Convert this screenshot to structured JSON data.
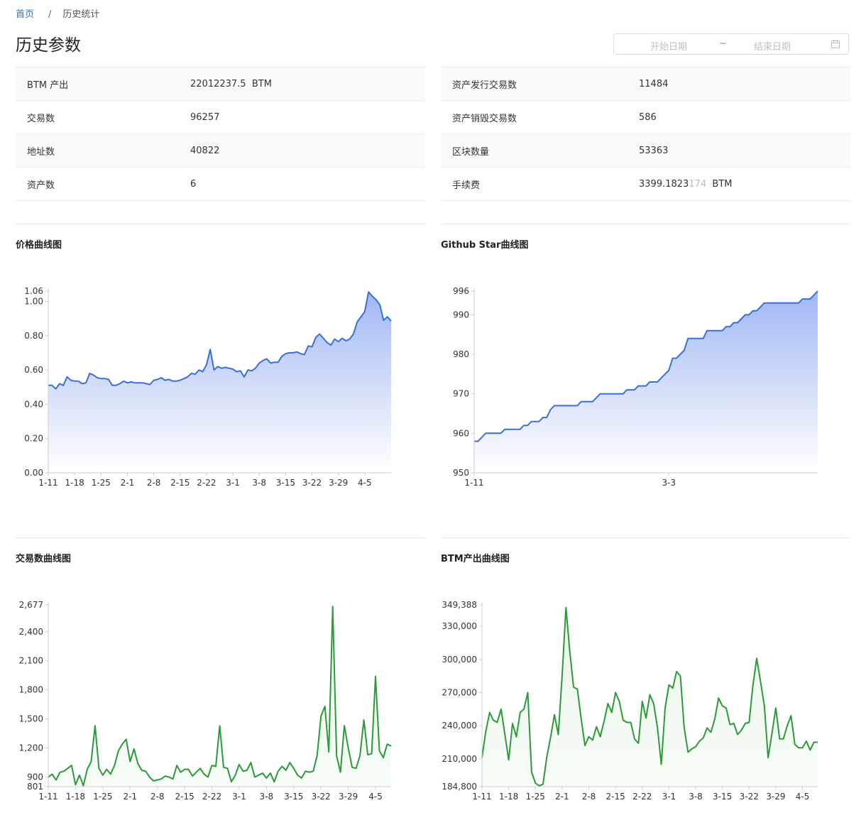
{
  "breadcrumb": {
    "home": "首页",
    "separator": "/",
    "current": "历史统计"
  },
  "page_title": "历史参数",
  "date_range": {
    "start_placeholder": "开始日期",
    "separator": "~",
    "end_placeholder": "结束日期"
  },
  "stats_left": [
    {
      "label": "BTM 产出",
      "value": "22012237.5  BTM"
    },
    {
      "label": "交易数",
      "value": "96257"
    },
    {
      "label": "地址数",
      "value": "40822"
    },
    {
      "label": "资产数",
      "value": "6"
    }
  ],
  "stats_right": [
    {
      "label": "资产发行交易数",
      "value": "11484"
    },
    {
      "label": "资产销毁交易数",
      "value": "586"
    },
    {
      "label": "区块数量",
      "value": "53363"
    },
    {
      "label": "手续费",
      "value_main": "3399.1823",
      "value_dim": "174",
      "value_unit": "  BTM"
    }
  ],
  "charts": {
    "price": {
      "title": "价格曲线图"
    },
    "star": {
      "title": "Github Star曲线图"
    },
    "tx": {
      "title": "交易数曲线图"
    },
    "btm": {
      "title": "BTM产出曲线图"
    }
  },
  "colors": {
    "blue": "#3a6fd8",
    "green": "#2a9a3a",
    "link": "#2f6fd6"
  },
  "chart_data": [
    {
      "id": "price",
      "type": "area",
      "title": "价格曲线图",
      "ylim": [
        0,
        1.06
      ],
      "yticks": [
        0,
        0.2,
        0.4,
        0.6,
        0.8,
        1.0,
        1.06
      ],
      "ytick_labels": [
        "0.00",
        "0.20",
        "0.40",
        "0.60",
        "0.80",
        "1.00",
        "1.06"
      ],
      "xtick_labels": [
        "1-11",
        "1-18",
        "1-25",
        "2-1",
        "2-8",
        "2-15",
        "2-22",
        "3-1",
        "3-8",
        "3-15",
        "3-22",
        "3-29",
        "4-5"
      ],
      "xtick_index": [
        0,
        7,
        14,
        21,
        28,
        35,
        42,
        49,
        56,
        63,
        70,
        77,
        84
      ],
      "grid": false,
      "values": [
        0.51,
        0.51,
        0.49,
        0.52,
        0.51,
        0.56,
        0.54,
        0.535,
        0.535,
        0.52,
        0.525,
        0.58,
        0.57,
        0.555,
        0.55,
        0.55,
        0.545,
        0.51,
        0.51,
        0.52,
        0.535,
        0.525,
        0.53,
        0.525,
        0.525,
        0.525,
        0.52,
        0.515,
        0.54,
        0.545,
        0.555,
        0.54,
        0.545,
        0.535,
        0.535,
        0.54,
        0.55,
        0.56,
        0.58,
        0.575,
        0.6,
        0.59,
        0.63,
        0.72,
        0.6,
        0.62,
        0.61,
        0.615,
        0.61,
        0.605,
        0.59,
        0.595,
        0.56,
        0.6,
        0.595,
        0.61,
        0.64,
        0.655,
        0.665,
        0.64,
        0.645,
        0.645,
        0.68,
        0.695,
        0.7,
        0.7,
        0.705,
        0.695,
        0.69,
        0.74,
        0.735,
        0.79,
        0.81,
        0.785,
        0.76,
        0.745,
        0.78,
        0.765,
        0.785,
        0.77,
        0.78,
        0.81,
        0.88,
        0.91,
        0.94,
        1.055,
        1.03,
        1.01,
        0.98,
        0.89,
        0.91,
        0.885
      ]
    },
    {
      "id": "star",
      "type": "area",
      "title": "Github Star曲线图",
      "ylim": [
        950,
        996
      ],
      "yticks": [
        950,
        960,
        970,
        980,
        990,
        996
      ],
      "ytick_labels": [
        "950",
        "960",
        "970",
        "980",
        "990",
        "996"
      ],
      "xtick_labels": [
        "1-11",
        "3-3"
      ],
      "xtick_index": [
        0,
        51
      ],
      "grid": false,
      "values": [
        958,
        958,
        959,
        960,
        960,
        960,
        960,
        960,
        961,
        961,
        961,
        961,
        961,
        962,
        962,
        963,
        963,
        963,
        964,
        964,
        966,
        967,
        967,
        967,
        967,
        967,
        967,
        967,
        968,
        968,
        968,
        968,
        969,
        970,
        970,
        970,
        970,
        970,
        970,
        970,
        971,
        971,
        971,
        972,
        972,
        972,
        973,
        973,
        973,
        974,
        975,
        976,
        979,
        979,
        980,
        981,
        984,
        984,
        984,
        984,
        984,
        986,
        986,
        986,
        986,
        986,
        987,
        987,
        988,
        988,
        989,
        990,
        990,
        991,
        991,
        992,
        993,
        993,
        993,
        993,
        993,
        993,
        993,
        993,
        993,
        993,
        994,
        994,
        994,
        995,
        996
      ]
    },
    {
      "id": "tx",
      "type": "area",
      "title": "交易数曲线图",
      "ylim": [
        801,
        2677
      ],
      "yticks": [
        801,
        900,
        1200,
        1500,
        1800,
        2100,
        2400,
        2677
      ],
      "ytick_labels": [
        "801",
        "900",
        "1,200",
        "1,500",
        "1,800",
        "2,100",
        "2,400",
        "2,677"
      ],
      "xtick_labels": [
        "1-11",
        "1-18",
        "1-25",
        "2-1",
        "2-8",
        "2-15",
        "2-22",
        "3-1",
        "3-8",
        "3-15",
        "3-22",
        "3-29",
        "4-5"
      ],
      "xtick_index": [
        0,
        7,
        14,
        21,
        28,
        35,
        42,
        49,
        56,
        63,
        70,
        77,
        84
      ],
      "grid": false,
      "values": [
        900,
        930,
        870,
        950,
        960,
        990,
        1020,
        820,
        920,
        810,
        980,
        1060,
        1430,
        990,
        920,
        980,
        930,
        1020,
        1170,
        1240,
        1290,
        1060,
        1190,
        1040,
        970,
        960,
        900,
        860,
        870,
        880,
        910,
        900,
        880,
        1020,
        950,
        980,
        980,
        910,
        950,
        990,
        930,
        900,
        1020,
        1010,
        1430,
        1000,
        990,
        850,
        920,
        1030,
        960,
        970,
        1050,
        900,
        920,
        940,
        890,
        940,
        850,
        960,
        1010,
        970,
        1050,
        990,
        920,
        890,
        960,
        950,
        960,
        1120,
        1530,
        1630,
        1160,
        2660,
        1120,
        950,
        1430,
        1200,
        1000,
        990,
        1120,
        1490,
        1130,
        1140,
        1940,
        1170,
        1100,
        1240,
        1220
      ]
    },
    {
      "id": "btm",
      "type": "area",
      "title": "BTM产出曲线图",
      "ylim": [
        184800,
        349388
      ],
      "yticks": [
        184800,
        210000,
        240000,
        270000,
        300000,
        330000,
        349388
      ],
      "ytick_labels": [
        "184,800",
        "210,000",
        "240,000",
        "270,000",
        "300,000",
        "330,000",
        "349,388"
      ],
      "xtick_labels": [
        "1-11",
        "1-18",
        "1-25",
        "2-1",
        "2-8",
        "2-15",
        "2-22",
        "3-1",
        "3-8",
        "3-15",
        "3-22",
        "3-29",
        "4-5"
      ],
      "xtick_index": [
        0,
        7,
        14,
        21,
        28,
        35,
        42,
        49,
        56,
        63,
        70,
        77,
        84
      ],
      "grid": false,
      "values": [
        211000,
        235000,
        252000,
        245000,
        243000,
        255000,
        232000,
        209000,
        242000,
        230000,
        252000,
        255000,
        270000,
        198000,
        188000,
        185500,
        187000,
        212000,
        230000,
        250000,
        232000,
        285000,
        347000,
        308000,
        275000,
        273000,
        246000,
        222000,
        230000,
        227000,
        239000,
        230000,
        244000,
        260000,
        252000,
        270000,
        262000,
        245000,
        243000,
        243000,
        228000,
        224000,
        262000,
        247000,
        268000,
        260000,
        238000,
        205000,
        256000,
        277000,
        274000,
        289000,
        285000,
        238000,
        216000,
        219000,
        221000,
        226000,
        229000,
        238000,
        234000,
        246000,
        265000,
        258000,
        256000,
        241000,
        242000,
        232000,
        236000,
        242000,
        243000,
        276000,
        301000,
        280000,
        258000,
        211000,
        233000,
        256000,
        228000,
        228000,
        240000,
        249000,
        223000,
        220000,
        220000,
        226000,
        218000,
        225000,
        225000
      ]
    }
  ]
}
